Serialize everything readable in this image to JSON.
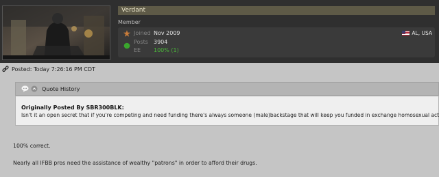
{
  "user": {
    "username": "Verdant",
    "title": "Member",
    "stats": [
      {
        "label": "Joined",
        "value": "Nov 2009",
        "icon": "star-icon"
      },
      {
        "label": "Posts",
        "value": "3904",
        "icon": "online-dot-icon"
      },
      {
        "label": "EE",
        "value": "100% (1)",
        "icon": ""
      }
    ],
    "location": "AL, USA"
  },
  "post": {
    "posted": "Posted: Today 7:26:16 PM CDT"
  },
  "quote": {
    "header": "Quote History",
    "author": "Originally Posted By SBR300BLK:",
    "text": "Isn't it an open secret that if you're competing and need funding there's always someone (male)backstage that will keep you funded in exchange homosexual activity?"
  },
  "body": {
    "line1": "100% correct.",
    "line2": "Nearly all IFBB pros need the assistance of wealthy \"patrons\" in order to afford their drugs."
  },
  "colors": {
    "online": "#3aa62d",
    "star": "#c97c3a",
    "ee_green": "#4bb83a"
  }
}
